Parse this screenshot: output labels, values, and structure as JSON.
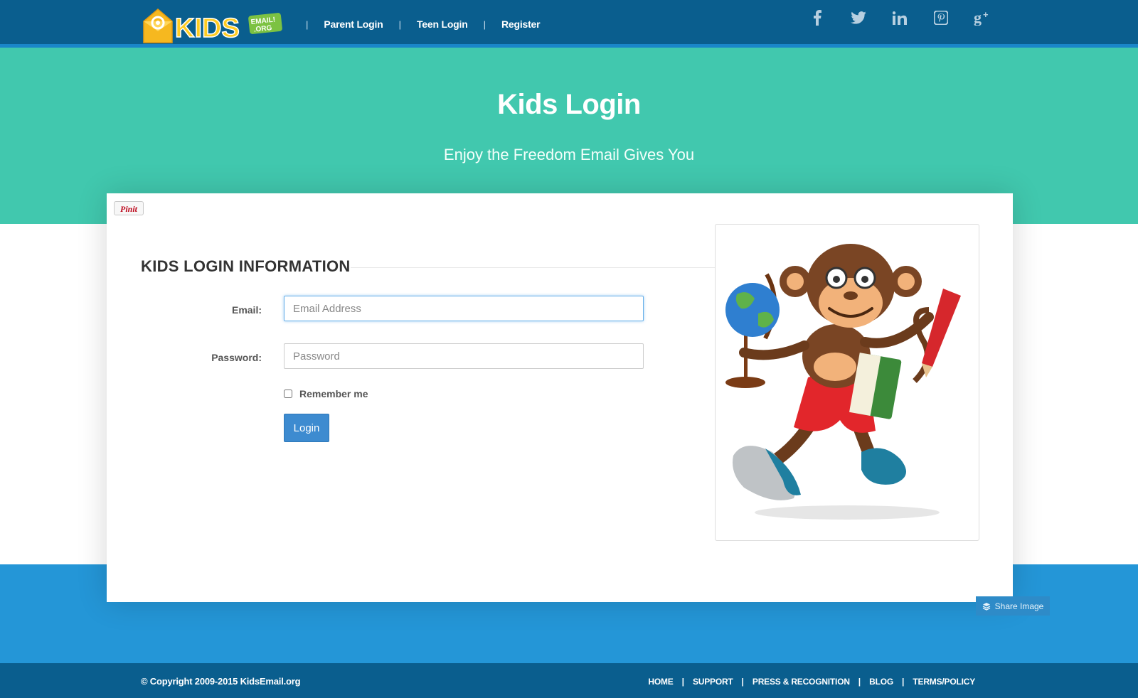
{
  "header": {
    "logo_text": "KIDS",
    "logo_badge": "EMAIL!.ORG",
    "nav": [
      {
        "label": "Parent Login"
      },
      {
        "label": "Teen Login"
      },
      {
        "label": "Register"
      }
    ],
    "social": [
      "facebook-icon",
      "twitter-icon",
      "linkedin-icon",
      "pinterest-icon",
      "google-plus-icon"
    ]
  },
  "hero": {
    "title": "Kids Login",
    "subtitle": "Enjoy the Freedom Email Gives You"
  },
  "card": {
    "pinit_label": "Pinit",
    "section_title": "KIDS LOGIN INFORMATION",
    "email": {
      "label": "Email:",
      "placeholder": "Email Address",
      "value": ""
    },
    "password": {
      "label": "Password:",
      "placeholder": "Password",
      "value": ""
    },
    "remember_label": "Remember me",
    "remember_checked": false,
    "login_button": "Login",
    "image": "monkey-mascot-illustration"
  },
  "share_label": "Share Image",
  "footer": {
    "copyright": "© Copyright 2009-2015 KidsEmail.org",
    "links": [
      "HOME",
      "SUPPORT",
      "PRESS & RECOGNITION",
      "BLOG",
      "TERMS/POLICY"
    ]
  },
  "colors": {
    "nav_bg": "#0a5e8e",
    "hero_bg": "#41c8ae",
    "band_bg": "#2496d7",
    "button": "#3d8bd0"
  }
}
